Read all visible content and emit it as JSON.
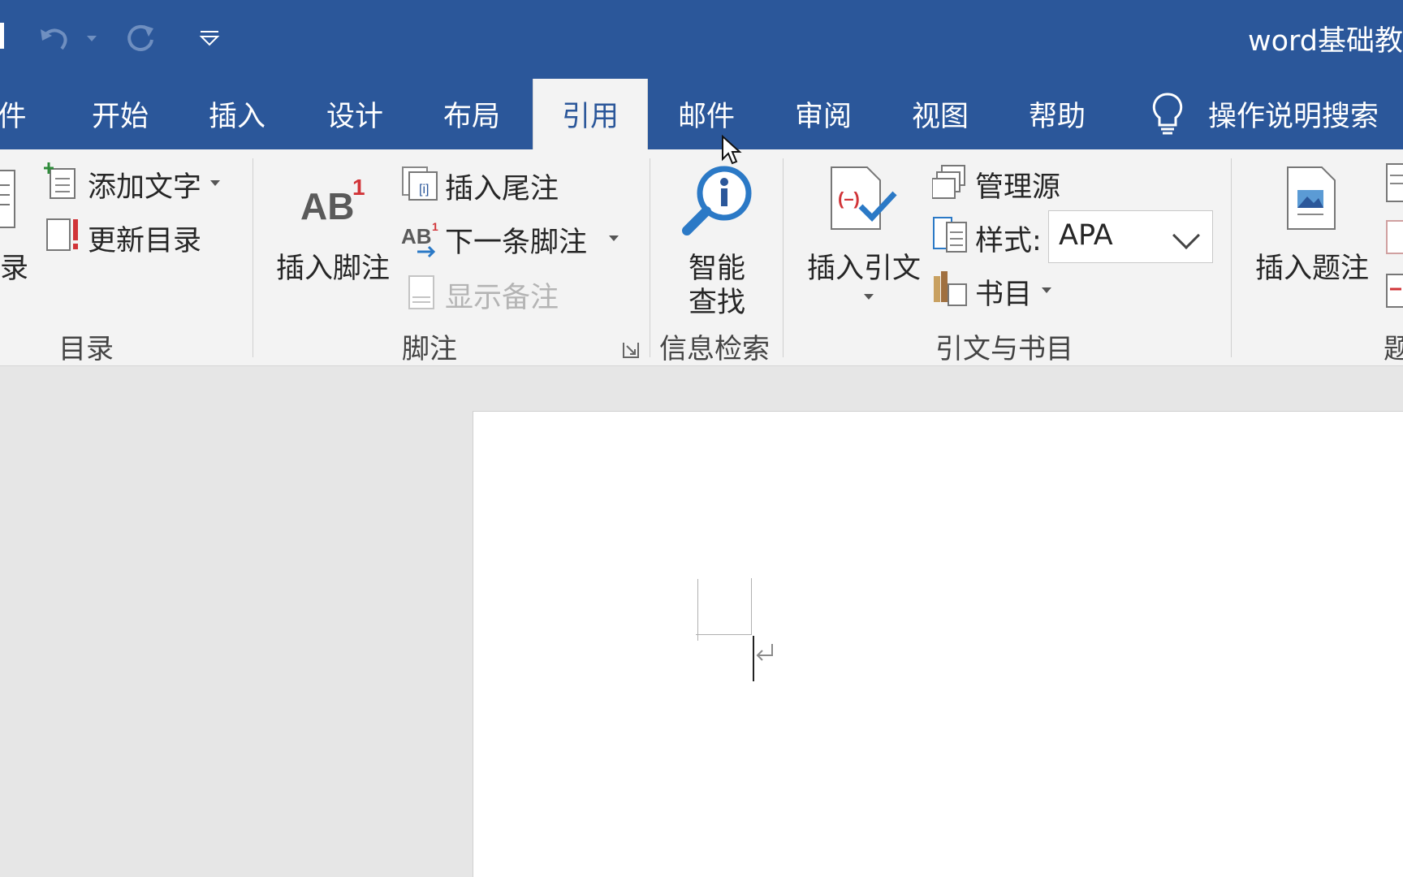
{
  "colors": {
    "brand": "#2b579a",
    "ribbon_bg": "#f3f3f3",
    "canvas_bg": "#e6e6e6",
    "accent_red": "#d13438"
  },
  "title_bar": {
    "doc_title": "word基础教"
  },
  "tabs": [
    {
      "label": "件"
    },
    {
      "label": "开始"
    },
    {
      "label": "插入"
    },
    {
      "label": "设计"
    },
    {
      "label": "布局"
    },
    {
      "label": "引用",
      "active": true
    },
    {
      "label": "邮件"
    },
    {
      "label": "审阅"
    },
    {
      "label": "视图"
    },
    {
      "label": "帮助"
    }
  ],
  "tell_me": {
    "label": "操作说明搜索"
  },
  "ribbon": {
    "toc_group": {
      "toc_label": "录",
      "add_text": "添加文字",
      "update_toc": "更新目录",
      "group_label": "目录"
    },
    "footnotes_group": {
      "insert_footnote": "插入脚注",
      "insert_endnote": "插入尾注",
      "next_footnote": "下一条脚注",
      "show_notes": "显示备注",
      "group_label": "脚注",
      "ab_icon_text": "AB",
      "ab_icon_sup": "1"
    },
    "research_group": {
      "smart_lookup_line1": "智能",
      "smart_lookup_line2": "查找",
      "group_label": "信息检索"
    },
    "citations_group": {
      "insert_citation": "插入引文",
      "manage_sources": "管理源",
      "style_label": "样式:",
      "style_value": "APA",
      "bibliography": "书目",
      "group_label": "引文与书目"
    },
    "captions_group": {
      "insert_caption": "插入题注",
      "group_label": "题"
    }
  }
}
